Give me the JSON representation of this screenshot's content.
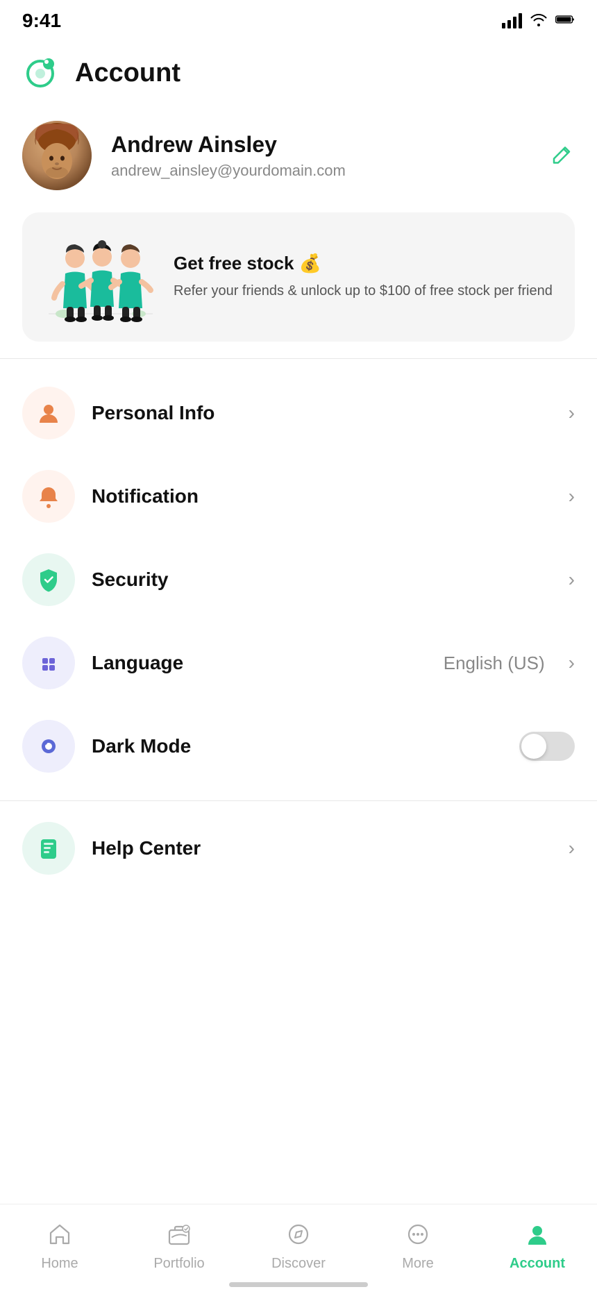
{
  "statusBar": {
    "time": "9:41"
  },
  "header": {
    "title": "Account",
    "logoAlt": "app-logo"
  },
  "profile": {
    "name": "Andrew Ainsley",
    "email": "andrew_ainsley@yourdomain.com",
    "editLabel": "edit"
  },
  "referral": {
    "title": "Get free stock 💰",
    "description": "Refer your friends & unlock up to $100 of free stock per friend"
  },
  "menuItems": [
    {
      "id": "personal-info",
      "label": "Personal Info",
      "iconColor": "#fff3ee",
      "iconBg": "#fff3ee",
      "iconFill": "#e8834a",
      "value": "",
      "type": "chevron"
    },
    {
      "id": "notification",
      "label": "Notification",
      "iconColor": "#fff3ee",
      "iconBg": "#fff3ee",
      "iconFill": "#e8834a",
      "value": "",
      "type": "chevron"
    },
    {
      "id": "security",
      "label": "Security",
      "iconColor": "#e8f7f1",
      "iconBg": "#e8f7f1",
      "iconFill": "#2ecc8a",
      "value": "",
      "type": "chevron"
    },
    {
      "id": "language",
      "label": "Language",
      "iconColor": "#eeeefc",
      "iconBg": "#eeeefc",
      "iconFill": "#6c63d8",
      "value": "English (US)",
      "type": "chevron"
    },
    {
      "id": "dark-mode",
      "label": "Dark Mode",
      "iconColor": "#eeeefc",
      "iconBg": "#eeeefc",
      "iconFill": "#5b69d6",
      "value": "",
      "type": "toggle"
    }
  ],
  "helpItem": {
    "label": "Help Center",
    "id": "help-center"
  },
  "bottomNav": {
    "items": [
      {
        "id": "home",
        "label": "Home",
        "active": false
      },
      {
        "id": "portfolio",
        "label": "Portfolio",
        "active": false
      },
      {
        "id": "discover",
        "label": "Discover",
        "active": false
      },
      {
        "id": "more",
        "label": "More",
        "active": false
      },
      {
        "id": "account",
        "label": "Account",
        "active": true
      }
    ]
  }
}
